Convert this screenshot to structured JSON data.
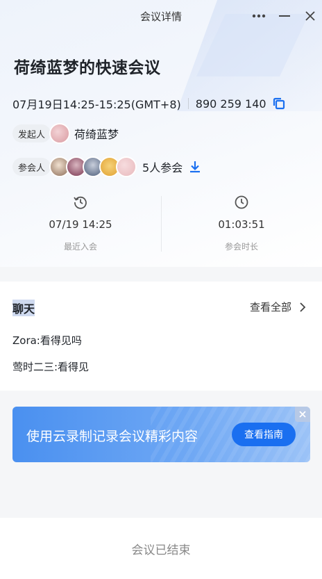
{
  "window": {
    "title": "会议详情"
  },
  "meeting": {
    "title": "荷绮蓝梦的快速会议",
    "time": "07月19日14:25-15:25(GMT+8)",
    "meeting_id": "890 259 140"
  },
  "host": {
    "tag": "发起人",
    "name": "荷绮蓝梦"
  },
  "participants": {
    "tag": "参会人",
    "count_text": "5人参会",
    "avatar_colors": [
      "#8a6a55",
      "#7a3550",
      "#4c5d7a",
      "#e0a030",
      "#e8b8bc"
    ]
  },
  "stats": {
    "last_join": {
      "value": "07/19 14:25",
      "label": "最近入会"
    },
    "duration": {
      "value": "01:03:51",
      "label": "参会时长"
    }
  },
  "chat": {
    "title": "聊天",
    "view_all": "查看全部",
    "messages": [
      {
        "text": "Zora:看得见吗"
      },
      {
        "text": "莺时二三:看得见"
      }
    ]
  },
  "banner": {
    "text": "使用云录制记录会议精彩内容",
    "button": "查看指南"
  },
  "footer": {
    "status": "会议已结束"
  },
  "colors": {
    "accent": "#1a6ff0",
    "banner_start": "#4a90f0"
  }
}
